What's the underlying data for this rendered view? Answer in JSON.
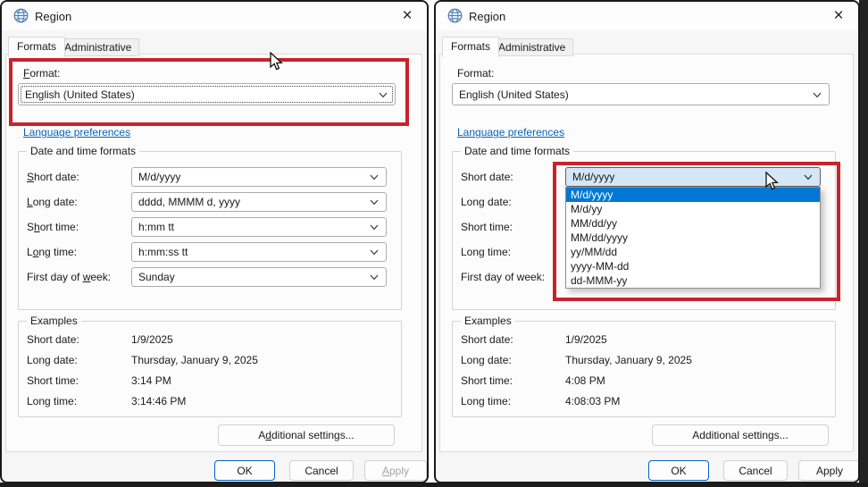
{
  "colors": {
    "annotation_red": "#c8232c",
    "selection_blue": "#0078d4",
    "link_blue": "#0a63b8",
    "combo_hover_blue": "#d5e7f7"
  },
  "left_window": {
    "title": "Region",
    "tabs": {
      "formats": "Formats",
      "administrative": "Administrative"
    },
    "format_label": "_F_ormat:",
    "format_value": "English (United States)",
    "language_link": "Language preferences",
    "datetime_group": {
      "title": "Date and time formats",
      "short_date_label": "_S_hort date:",
      "short_date_value": "M/d/yyyy",
      "long_date_label": "_L_ong date:",
      "long_date_value": "dddd, MMMM d, yyyy",
      "short_time_label": "S_h_ort time:",
      "short_time_value": "h:mm tt",
      "long_time_label": "L_o_ng time:",
      "long_time_value": "h:mm:ss tt",
      "first_day_label": "First day of _w_eek:",
      "first_day_value": "Sunday"
    },
    "examples_group": {
      "title": "Examples",
      "short_date_label": "Short date:",
      "short_date_value": "1/9/2025",
      "long_date_label": "Long date:",
      "long_date_value": "Thursday, January 9, 2025",
      "short_time_label": "Short time:",
      "short_time_value": "3:14 PM",
      "long_time_label": "Long time:",
      "long_time_value": "3:14:46 PM"
    },
    "additional_settings": "A_d_ditional settings...",
    "ok": "OK",
    "cancel": "Cancel",
    "apply": "_A_pply"
  },
  "right_window": {
    "title": "Region",
    "tabs": {
      "formats": "Formats",
      "administrative": "Administrative"
    },
    "format_label": "Format:",
    "format_value": "English (United States)",
    "language_link": "Language preferences",
    "datetime_group": {
      "title": "Date and time formats",
      "short_date_label": "Short date:",
      "short_date_value": "M/d/yyyy",
      "long_date_label": "Long date:",
      "short_time_label": "Short time:",
      "long_time_label": "Long time:",
      "first_day_label": "First day of week:",
      "dropdown_selected": "M/d/yyyy",
      "dropdown_options": [
        "M/d/yyyy",
        "M/d/yy",
        "MM/dd/yy",
        "MM/dd/yyyy",
        "yy/MM/dd",
        "yyyy-MM-dd",
        "dd-MMM-yy"
      ]
    },
    "examples_group": {
      "title": "Examples",
      "short_date_label": "Short date:",
      "short_date_value": "1/9/2025",
      "long_date_label": "Long date:",
      "long_date_value": "Thursday, January 9, 2025",
      "short_time_label": "Short time:",
      "short_time_value": "4:08 PM",
      "long_time_label": "Long time:",
      "long_time_value": "4:08:03 PM"
    },
    "additional_settings": "Additional settings...",
    "ok": "OK",
    "cancel": "Cancel",
    "apply": "Apply"
  }
}
